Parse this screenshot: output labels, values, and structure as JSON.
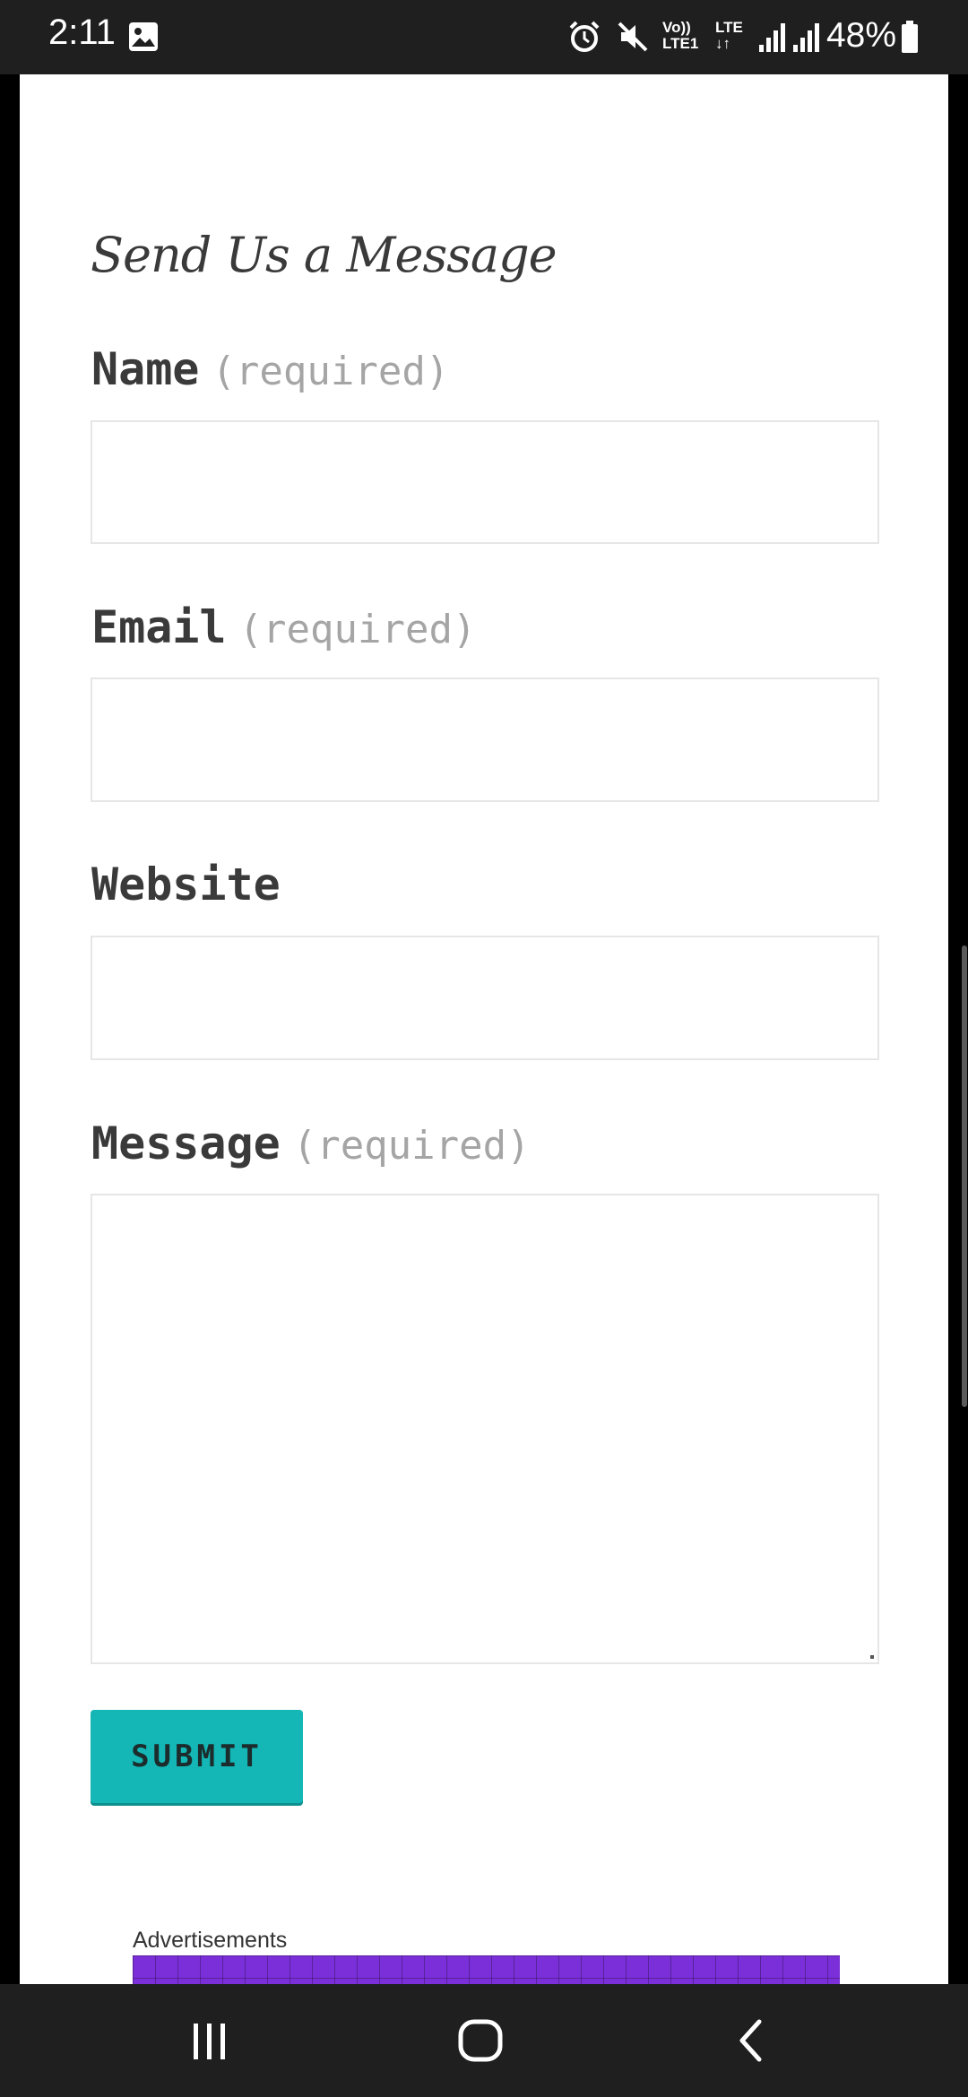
{
  "status_bar": {
    "time": "2:11",
    "battery": "48%",
    "icons": [
      "gallery-icon",
      "alarm-icon",
      "mute-icon",
      "volte-icon",
      "lte-icon",
      "signal-icon",
      "signal-icon",
      "battery-icon"
    ],
    "volte_line1": "Vo))",
    "volte_line2": "LTE1",
    "lte_label": "LTE"
  },
  "form": {
    "heading": "Send Us a Message",
    "required_text": "(required)",
    "fields": [
      {
        "label": "Name",
        "required": true,
        "value": ""
      },
      {
        "label": "Email",
        "required": true,
        "value": ""
      },
      {
        "label": "Website",
        "required": false,
        "value": ""
      },
      {
        "label": "Message",
        "required": true,
        "value": ""
      }
    ],
    "submit_label": "SUBMIT"
  },
  "ads": {
    "label": "Advertisements",
    "banner_color": "#7b2fd8"
  },
  "colors": {
    "accent": "#14b6b6",
    "text": "#3a3a3a",
    "muted": "#a5a5a5"
  },
  "nav_bar": {
    "icons": [
      "recents-icon",
      "home-icon",
      "back-icon"
    ]
  }
}
